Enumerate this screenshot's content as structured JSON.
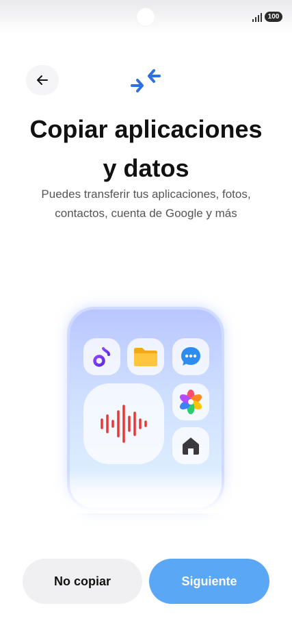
{
  "status": {
    "battery": "100"
  },
  "header": {
    "title_line1": "Copiar aplicaciones",
    "title_line2": "y datos",
    "subtitle_line1": "Puedes transferir tus aplicaciones, fotos,",
    "subtitle_line2": "contactos, cuenta de Google y más"
  },
  "illustration": {
    "apps": [
      "music-app-icon",
      "files-app-icon",
      "messages-app-icon",
      "sound-recorder-icon",
      "photos-app-icon",
      "home-app-icon"
    ]
  },
  "actions": {
    "skip_label": "No copiar",
    "next_label": "Siguiente"
  },
  "colors": {
    "accent": "#5aa7f6",
    "transfer_icon": "#2f6fe0",
    "recorder_wave": "#e53935"
  }
}
